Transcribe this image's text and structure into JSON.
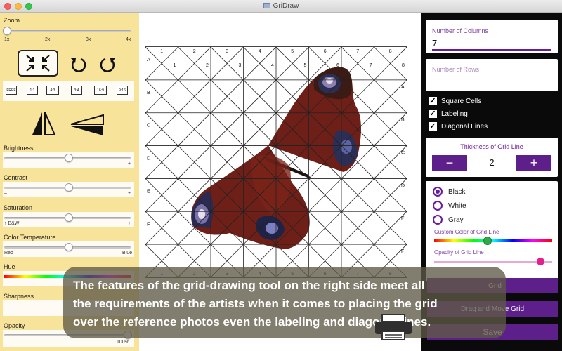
{
  "window": {
    "title": "GriDraw"
  },
  "left": {
    "zoom": {
      "label": "Zoom",
      "ticks": [
        "1x",
        "2x",
        "3x",
        "4x"
      ],
      "level": 0.0
    },
    "ratios": [
      "FREE",
      "1:1",
      "4:3",
      "3:4",
      "16:9",
      "9:16"
    ],
    "brightness": {
      "label": "Brightness",
      "min": "–",
      "max": "+",
      "level": 0.5
    },
    "contrast": {
      "label": "Contrast",
      "min": "–",
      "max": "+",
      "level": 0.5
    },
    "saturation": {
      "label": "Saturation",
      "min": "↑ B&W",
      "max": "+",
      "level": 0.5
    },
    "temperature": {
      "label": "Color Temperature",
      "min": "Red",
      "max": "Blue",
      "level": 0.5
    },
    "hue": {
      "label": "Hue"
    },
    "sharpness": {
      "label": "Sharpness"
    },
    "opacity": {
      "label": "Opacity",
      "max": "100%",
      "level": 1.0
    }
  },
  "grid": {
    "col_labels": [
      "1",
      "2",
      "3",
      "4",
      "5",
      "6",
      "7",
      "8"
    ],
    "row_labels": [
      "A",
      "B",
      "C",
      "D",
      "E",
      "F"
    ],
    "bottom_labels": [
      "1",
      "2",
      "3",
      "4",
      "5",
      "6",
      "7",
      "8"
    ]
  },
  "right": {
    "columns": {
      "label": "Number of Columns",
      "value": "7"
    },
    "rows": {
      "label": "Number of Rows",
      "value": ""
    },
    "checks": [
      {
        "label": "Square Cells",
        "checked": true
      },
      {
        "label": "Labeling",
        "checked": true
      },
      {
        "label": "Diagonal Lines",
        "checked": true
      }
    ],
    "thickness": {
      "label": "Thickness of Grid Line",
      "value": "2",
      "minus": "−",
      "plus": "+"
    },
    "colors": [
      {
        "label": "Black",
        "selected": true
      },
      {
        "label": "White",
        "selected": false
      },
      {
        "label": "Gray",
        "selected": false
      }
    ],
    "custom_color_label": "Custom Color of Grid Line",
    "opacity_label": "Opacity of Grid Line",
    "btn_grid": "Grid",
    "btn_drag": "Drag and Move Grid",
    "btn_save": "Save"
  },
  "caption": {
    "line1": "The features of the grid-drawing tool on the right side meet all",
    "line2": "the requirements of the artists when it comes to placing the grid",
    "line3": "over the reference photos even the labeling and diagonal lines."
  },
  "colors": {
    "accent": "#5d208a",
    "left_bg": "#f7e39a",
    "right_bg": "#0a0a0a"
  }
}
